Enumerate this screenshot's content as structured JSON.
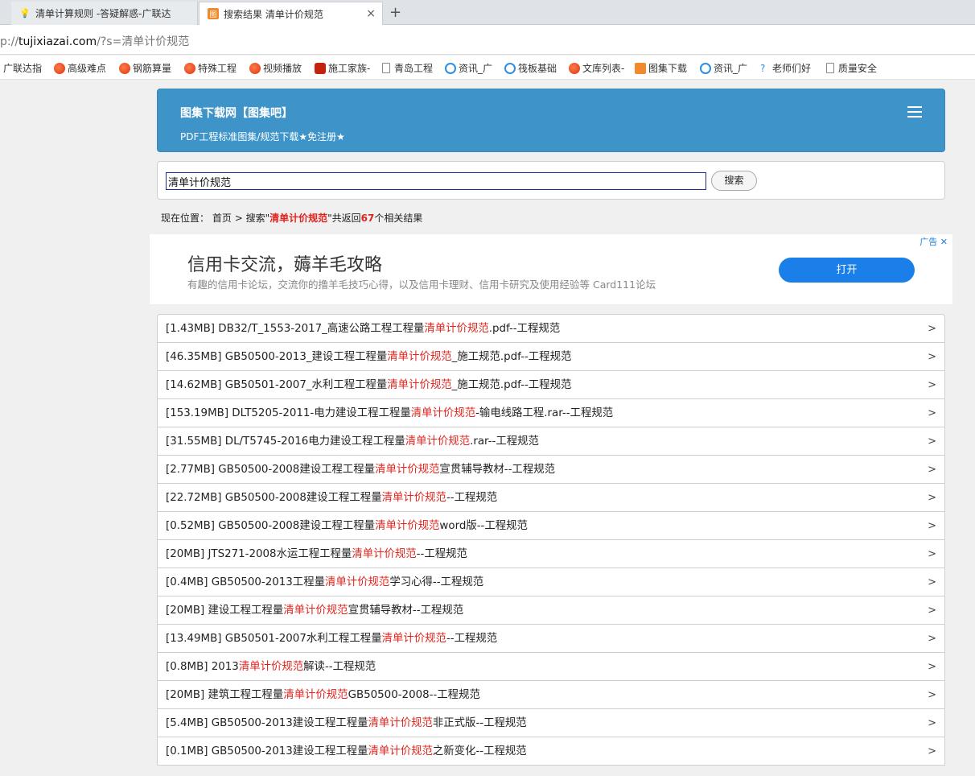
{
  "browser": {
    "tabs": [
      {
        "title": "清单计算规则 -答疑解惑-广联达",
        "icon": "lightbulb-icon"
      },
      {
        "title": "搜索结果 清单计价规范",
        "icon": "site-favicon-icon"
      }
    ],
    "new_tab_label": "+",
    "close_label": "×",
    "url_prefix": "p://",
    "url_host": "tujixiazai.com",
    "url_path": "/?s=清单计价规范",
    "bookmarks": [
      {
        "label": "广联达指",
        "icon": "none"
      },
      {
        "label": "高级难点",
        "icon": "red"
      },
      {
        "label": "钢筋算量",
        "icon": "red"
      },
      {
        "label": "特殊工程",
        "icon": "red"
      },
      {
        "label": "视频播放",
        "icon": "red"
      },
      {
        "label": "施工家族-",
        "icon": "redbox"
      },
      {
        "label": "青岛工程",
        "icon": "doc"
      },
      {
        "label": "资讯_广",
        "icon": "blue"
      },
      {
        "label": "筏板基础",
        "icon": "blue"
      },
      {
        "label": "文库列表-",
        "icon": "red"
      },
      {
        "label": "图集下载",
        "icon": "orange"
      },
      {
        "label": "资讯_广",
        "icon": "blue"
      },
      {
        "label": "老师们好",
        "icon": "bulb"
      },
      {
        "label": "质量安全",
        "icon": "doc"
      }
    ]
  },
  "header": {
    "title": "图集下载网【图集吧】",
    "subtitle": "PDF工程标准图集/规范下载★免注册★"
  },
  "search": {
    "value": "清单计价规范",
    "button_label": "搜索"
  },
  "breadcrumb": {
    "prefix": "现在位置：",
    "home": "首页",
    "separator": ">",
    "search_prefix": "搜索\"",
    "keyword": "清单计价规范",
    "mid": "\"共返回",
    "count": "67",
    "suffix": "个相关结果"
  },
  "ad": {
    "title": "信用卡交流，薅羊毛攻略",
    "description": "有趣的信用卡论坛，交流你的撸羊毛技巧心得，以及信用卡理财、信用卡研究及使用经验等 Card111论坛",
    "button_label": "打开",
    "tag": "广告"
  },
  "results": [
    {
      "before": "[1.43MB] DB32/T_1553-2017_高速公路工程工程量",
      "keyword": "清单计价规范",
      "after": ".pdf--工程规范"
    },
    {
      "before": "[46.35MB] GB50500-2013_建设工程工程量",
      "keyword": "清单计价规范",
      "after": "_施工规范.pdf--工程规范"
    },
    {
      "before": "[14.62MB] GB50501-2007_水利工程工程量",
      "keyword": "清单计价规范",
      "after": "_施工规范.pdf--工程规范"
    },
    {
      "before": "[153.19MB] DLT5205-2011-电力建设工程工程量",
      "keyword": "清单计价规范",
      "after": "-输电线路工程.rar--工程规范"
    },
    {
      "before": "[31.55MB] DL/T5745-2016电力建设工程工程量",
      "keyword": "清单计价规范",
      "after": ".rar--工程规范"
    },
    {
      "before": "[2.77MB] GB50500-2008建设工程工程量",
      "keyword": "清单计价规范",
      "after": "宣贯辅导教材--工程规范"
    },
    {
      "before": "[22.72MB] GB50500-2008建设工程工程量",
      "keyword": "清单计价规范",
      "after": "--工程规范"
    },
    {
      "before": "[0.52MB] GB50500-2008建设工程工程量",
      "keyword": "清单计价规范",
      "after": "word版--工程规范"
    },
    {
      "before": "[20MB] JTS271-2008水运工程工程量",
      "keyword": "清单计价规范",
      "after": "--工程规范"
    },
    {
      "before": "[0.4MB] GB50500-2013工程量",
      "keyword": "清单计价规范",
      "after": "学习心得--工程规范"
    },
    {
      "before": "[20MB] 建设工程工程量",
      "keyword": "清单计价规范",
      "after": "宣贯辅导教材--工程规范"
    },
    {
      "before": "[13.49MB] GB50501-2007水利工程工程量",
      "keyword": "清单计价规范",
      "after": "--工程规范"
    },
    {
      "before": "[0.8MB] 2013",
      "keyword": "清单计价规范",
      "after": "解读--工程规范"
    },
    {
      "before": "[20MB] 建筑工程工程量",
      "keyword": "清单计价规范",
      "after": "GB50500-2008--工程规范"
    },
    {
      "before": "[5.4MB] GB50500-2013建设工程工程量",
      "keyword": "清单计价规范",
      "after": "非正式版--工程规范"
    },
    {
      "before": "[0.1MB] GB50500-2013建设工程工程量",
      "keyword": "清单计价规范",
      "after": "之新变化--工程规范"
    }
  ],
  "row_arrow": ">",
  "colors": {
    "header_bg": "#3e94c9",
    "keyword": "#e0241d",
    "ad_button": "#1a7fe8"
  }
}
